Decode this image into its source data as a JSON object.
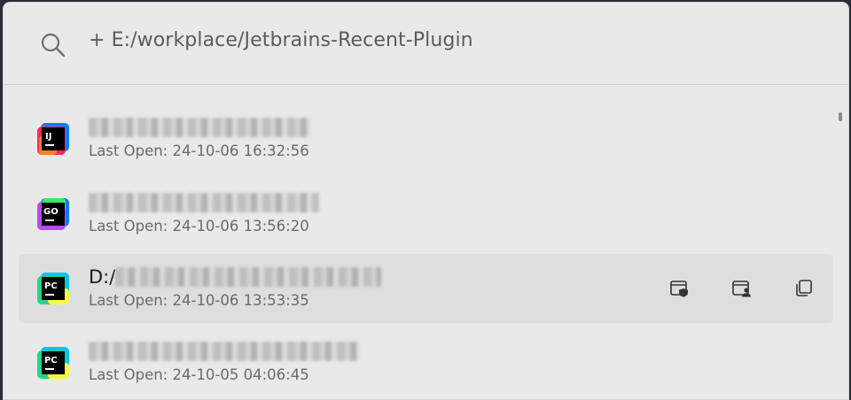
{
  "search": {
    "query": "+ E:/workplace/Jetbrains-Recent-Plugin",
    "icon": "search-icon"
  },
  "items": [
    {
      "ide": "IJ",
      "colors": [
        "#fe2857",
        "#fc801d",
        "#087cfa"
      ],
      "title_prefix": "",
      "last_open": "Last Open: 24-10-06 16:32:56",
      "selected": false
    },
    {
      "ide": "GO",
      "colors": [
        "#3bea62",
        "#087cfa",
        "#b74af7"
      ],
      "title_prefix": "",
      "last_open": "Last Open: 24-10-06 13:56:20",
      "selected": false
    },
    {
      "ide": "PC",
      "colors": [
        "#21d789",
        "#fcf84a",
        "#07c3f2"
      ],
      "title_prefix": "D:/",
      "last_open": "Last Open: 24-10-06 13:53:35",
      "selected": true
    },
    {
      "ide": "PC",
      "colors": [
        "#21d789",
        "#fcf84a",
        "#07c3f2"
      ],
      "title_prefix": "",
      "last_open": "Last Open: 24-10-05 04:06:45",
      "selected": false
    }
  ],
  "actions": [
    "open-in-admin-icon",
    "open-as-user-icon",
    "copy-path-icon"
  ]
}
